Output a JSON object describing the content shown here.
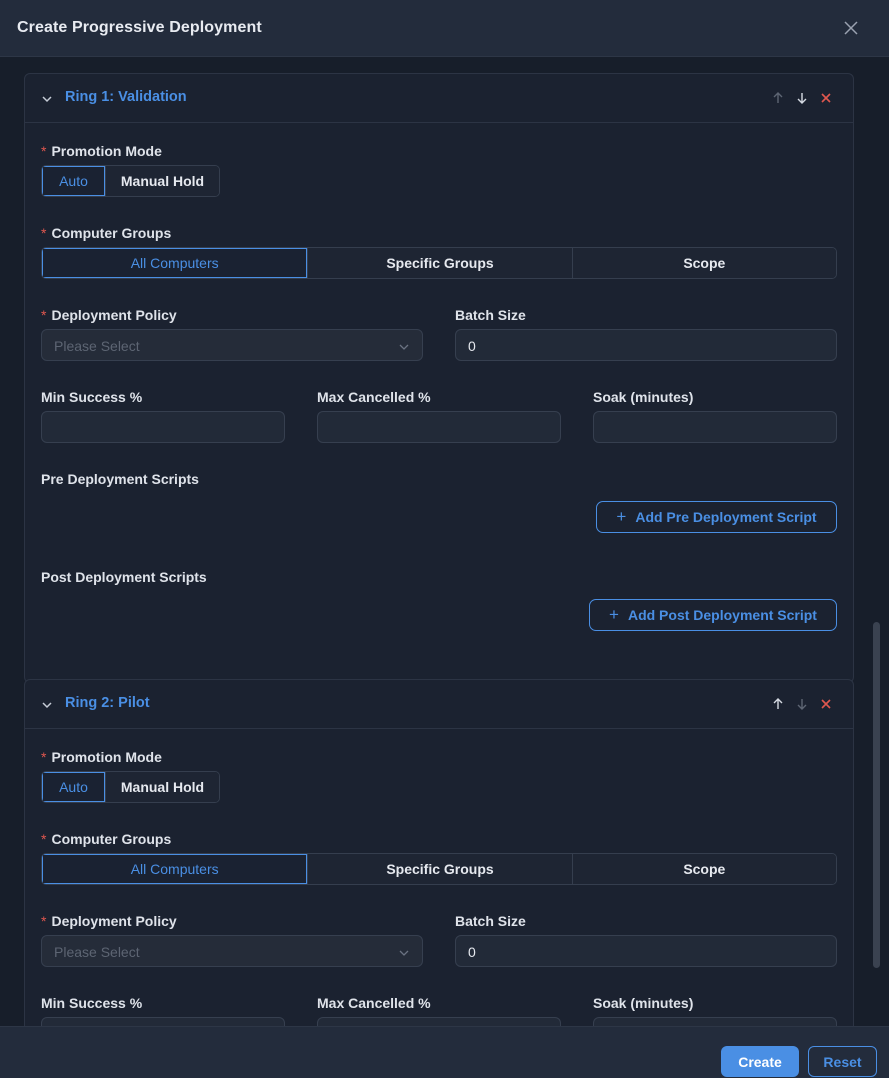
{
  "dialog": {
    "title": "Create Progressive Deployment"
  },
  "labels": {
    "promotion_mode": "Promotion Mode",
    "computer_groups": "Computer Groups",
    "deployment_policy": "Deployment Policy",
    "batch_size": "Batch Size",
    "min_success": "Min Success %",
    "max_cancelled": "Max Cancelled %",
    "soak": "Soak (minutes)",
    "pre_scripts": "Pre Deployment Scripts",
    "post_scripts": "Post Deployment Scripts",
    "required_mark": "*"
  },
  "rings": [
    {
      "title": "Ring 1: Validation",
      "promotion_modes": [
        "Auto",
        "Manual Hold"
      ],
      "selected_mode": "Auto",
      "group_options": [
        "All Computers",
        "Specific Groups",
        "Scope"
      ],
      "selected_group": "All Computers",
      "policy_placeholder": "Please Select",
      "batch_size": "0",
      "min_success": "",
      "max_cancelled": "",
      "soak": "",
      "add_pre_label": "Add Pre Deployment Script",
      "add_post_label": "Add Post Deployment Script"
    },
    {
      "title": "Ring 2: Pilot",
      "promotion_modes": [
        "Auto",
        "Manual Hold"
      ],
      "selected_mode": "Auto",
      "group_options": [
        "All Computers",
        "Specific Groups",
        "Scope"
      ],
      "selected_group": "All Computers",
      "policy_placeholder": "Please Select",
      "batch_size": "0"
    }
  ],
  "footer": {
    "create_label": "Create",
    "reset_label": "Reset"
  },
  "colors": {
    "accent": "#4a8fe4",
    "required": "#e0574f",
    "remove": "#e0574f"
  },
  "icons": [
    "close-icon",
    "chevron-down-icon",
    "arrow-up-icon",
    "arrow-down-icon",
    "remove-icon",
    "plus-icon"
  ]
}
